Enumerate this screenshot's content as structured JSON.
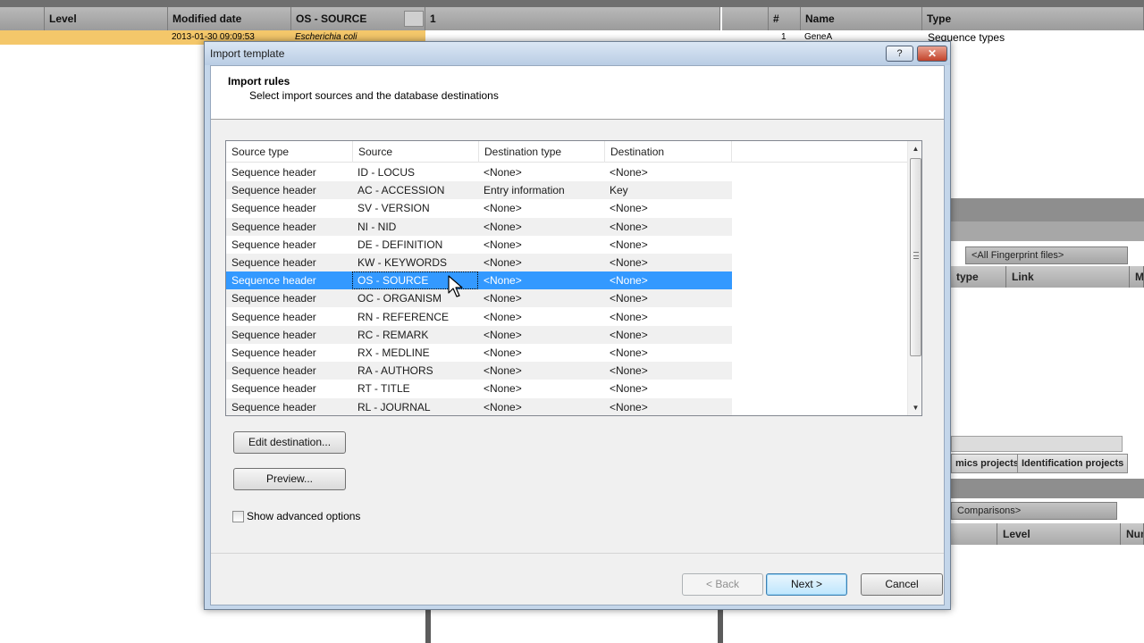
{
  "background": {
    "left_table_headers": [
      "Level",
      "Modified date",
      "OS - SOURCE",
      "1"
    ],
    "left_table_row": [
      "",
      "2013-01-30 09:09:53",
      "Escherichia coli"
    ],
    "right_table_headers": [
      "#",
      "Name",
      "Type"
    ],
    "right_table_row": [
      "1",
      "GeneA",
      "Sequence types"
    ],
    "fingerprint_filter": "<All Fingerprint files>",
    "link_headers": [
      "type",
      "Link",
      "M"
    ],
    "project_tabs": [
      "mics projects",
      "Identification projects"
    ],
    "comparisons_filter": "Comparisons>",
    "lower_headers": [
      "Level",
      "Num"
    ]
  },
  "dialog": {
    "title": "Import template",
    "help_label": "?",
    "close_label": "✕",
    "header_title": "Import rules",
    "header_subtitle": "Select import sources and the database destinations",
    "columns": [
      "Source type",
      "Source",
      "Destination type",
      "Destination"
    ],
    "rows": [
      [
        "Sequence header",
        "ID - LOCUS",
        "<None>",
        "<None>"
      ],
      [
        "Sequence header",
        "AC - ACCESSION",
        "Entry information",
        "Key"
      ],
      [
        "Sequence header",
        "SV - VERSION",
        "<None>",
        "<None>"
      ],
      [
        "Sequence header",
        "NI - NID",
        "<None>",
        "<None>"
      ],
      [
        "Sequence header",
        "DE - DEFINITION",
        "<None>",
        "<None>"
      ],
      [
        "Sequence header",
        "KW - KEYWORDS",
        "<None>",
        "<None>"
      ],
      [
        "Sequence header",
        "OS - SOURCE",
        "<None>",
        "<None>"
      ],
      [
        "Sequence header",
        "OC - ORGANISM",
        "<None>",
        "<None>"
      ],
      [
        "Sequence header",
        "RN - REFERENCE",
        "<None>",
        "<None>"
      ],
      [
        "Sequence header",
        "RC - REMARK",
        "<None>",
        "<None>"
      ],
      [
        "Sequence header",
        "RX - MEDLINE",
        "<None>",
        "<None>"
      ],
      [
        "Sequence header",
        "RA - AUTHORS",
        "<None>",
        "<None>"
      ],
      [
        "Sequence header",
        "RT - TITLE",
        "<None>",
        "<None>"
      ],
      [
        "Sequence header",
        "RL - JOURNAL",
        "<None>",
        "<None>"
      ]
    ],
    "selected_row": 6,
    "edit_destination_label": "Edit destination...",
    "preview_label": "Preview...",
    "show_advanced_label": "Show advanced options",
    "show_advanced_checked": false,
    "back_label": "< Back",
    "next_label": "Next >",
    "cancel_label": "Cancel"
  },
  "colors": {
    "selection": "#3399ff",
    "title_bar": "#c4d6ea",
    "close_button": "#c2432b"
  }
}
